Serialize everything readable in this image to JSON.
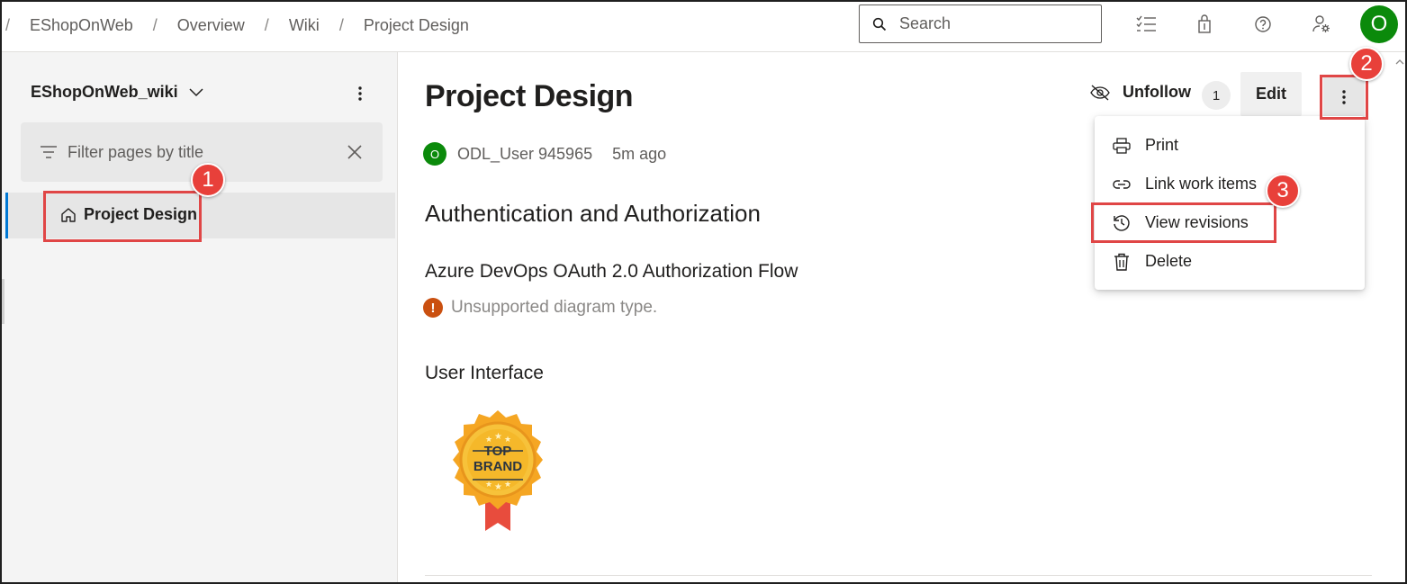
{
  "breadcrumbs": [
    "EShopOnWeb",
    "Overview",
    "Wiki",
    "Project Design"
  ],
  "search": {
    "placeholder": "Search"
  },
  "user": {
    "avatar_initial": "O",
    "avatar_color": "#0b8a0b"
  },
  "sidebar": {
    "wiki_name": "EShopOnWeb_wiki",
    "filter_placeholder": "Filter pages by title",
    "pages": [
      {
        "label": "Project Design",
        "selected": true
      }
    ]
  },
  "page": {
    "title": "Project Design",
    "author_initial": "O",
    "author": "ODL_User 945965",
    "time": "5m ago",
    "heading_auth": "Authentication and Authorization",
    "heading_oauth": "Azure DevOps OAuth 2.0 Authorization Flow",
    "unsupported": "Unsupported diagram type.",
    "heading_ui": "User Interface",
    "badge_line1": "TOP",
    "badge_line2": "BRAND"
  },
  "actions": {
    "unfollow_label": "Unfollow",
    "follow_count": "1",
    "edit_label": "Edit"
  },
  "menu": {
    "items": [
      {
        "label": "Print",
        "icon": "print-icon"
      },
      {
        "label": "Link work items",
        "icon": "link-icon"
      },
      {
        "label": "View revisions",
        "icon": "history-icon"
      },
      {
        "label": "Delete",
        "icon": "trash-icon"
      }
    ]
  },
  "annotations": [
    "1",
    "2",
    "3"
  ],
  "colors": {
    "accent": "#0078d4",
    "annotation": "#e8403a",
    "warning": "#ca5010"
  }
}
